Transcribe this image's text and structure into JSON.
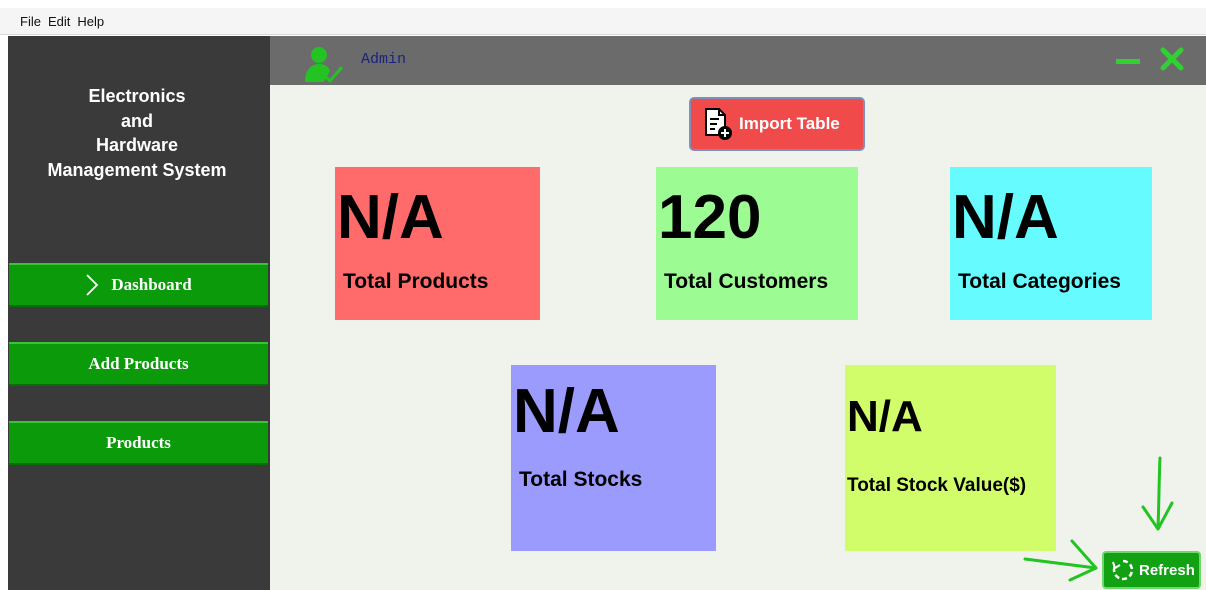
{
  "menubar": {
    "items": [
      "File",
      "Edit",
      "Help"
    ]
  },
  "sidebar": {
    "title_lines": [
      "Electronics",
      "and",
      "Hardware",
      "Management System"
    ],
    "nav": [
      {
        "label": "Dashboard",
        "icon": "chevron-right-icon"
      },
      {
        "label": "Add Products"
      },
      {
        "label": "Products"
      }
    ]
  },
  "topbar": {
    "user_label": "Admin",
    "icon": "user-check-icon"
  },
  "main": {
    "import_label": "Import Table",
    "cards": [
      {
        "value": "N/A",
        "label": "Total Products",
        "color": "#ff6b6b"
      },
      {
        "value": "120",
        "label": "Total Customers",
        "color": "#9cfb93"
      },
      {
        "value": "N/A",
        "label": "Total Categories",
        "color": "#66fbfe"
      },
      {
        "value": "N/A",
        "label": "Total Stocks",
        "color": "#9b9bfd"
      },
      {
        "value": "N/A",
        "label": "Total Stock Value($)",
        "color": "#d2fd6b"
      }
    ],
    "refresh_label": "Refresh"
  },
  "colors": {
    "accent_green": "#0a9a0a",
    "sidebar_bg": "#3a3a3a",
    "topbar_bg": "#6b6b6b",
    "main_bg": "#f0f3ec",
    "import_red": "#f04a4a",
    "annotation_green": "#22c322"
  }
}
